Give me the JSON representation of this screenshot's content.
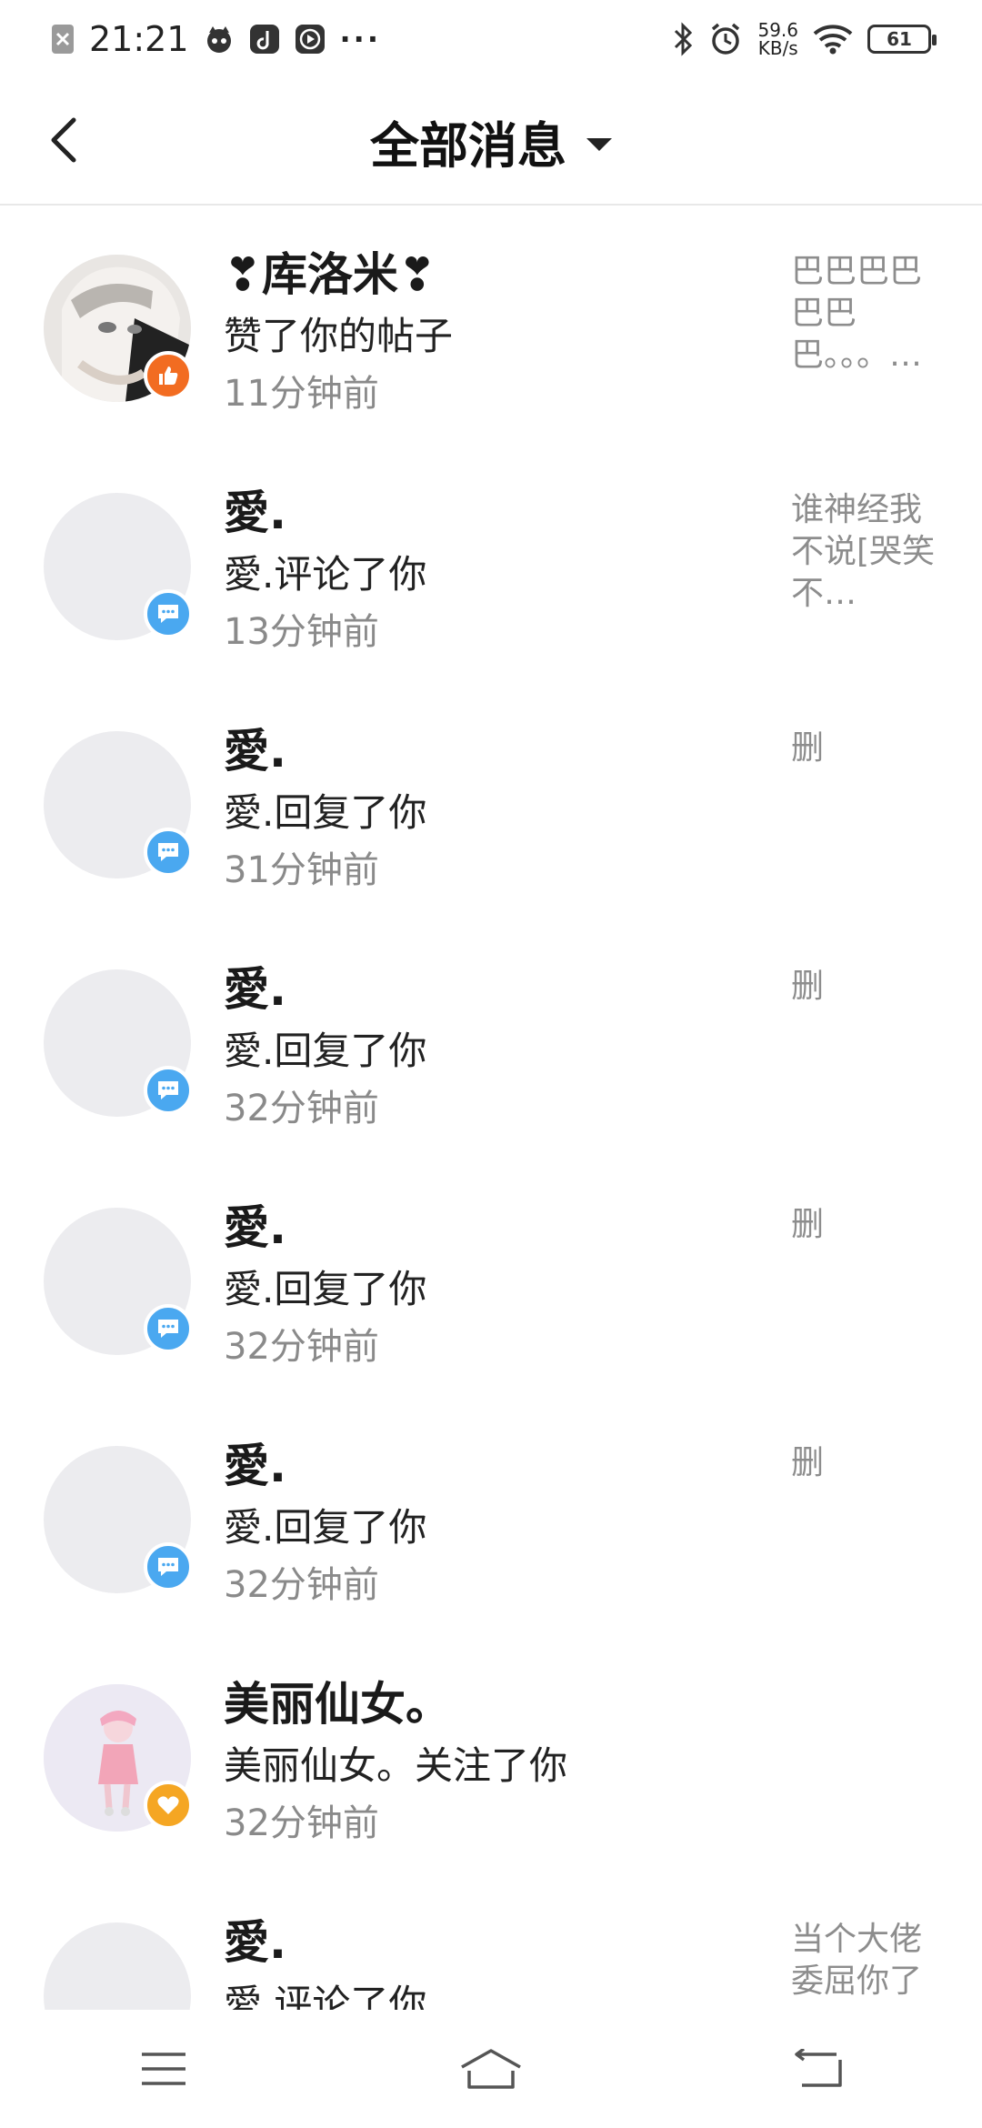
{
  "status_bar": {
    "time": "21:21",
    "net_speed_value": "59.6",
    "net_speed_unit": "KB/s",
    "battery": "61"
  },
  "header": {
    "title": "全部消息"
  },
  "messages": [
    {
      "name": "❣库洛米❣",
      "action": "赞了你的帖子",
      "time": "11分钟前",
      "preview": "巴巴巴巴巴巴巴。。。…",
      "badge": "like-icon",
      "badge_color": "#f26c21"
    },
    {
      "name": "愛.",
      "action": "愛.评论了你",
      "time": "13分钟前",
      "preview": "谁神经我不说[哭笑不…",
      "badge": "comment-icon",
      "badge_color": "#4aa8f0"
    },
    {
      "name": "愛.",
      "action": "愛.回复了你",
      "time": "31分钟前",
      "preview": "删",
      "badge": "comment-icon",
      "badge_color": "#4aa8f0"
    },
    {
      "name": "愛.",
      "action": "愛.回复了你",
      "time": "32分钟前",
      "preview": "删",
      "badge": "comment-icon",
      "badge_color": "#4aa8f0"
    },
    {
      "name": "愛.",
      "action": "愛.回复了你",
      "time": "32分钟前",
      "preview": "删",
      "badge": "comment-icon",
      "badge_color": "#4aa8f0"
    },
    {
      "name": "愛.",
      "action": "愛.回复了你",
      "time": "32分钟前",
      "preview": "删",
      "badge": "comment-icon",
      "badge_color": "#4aa8f0"
    },
    {
      "name": "美丽仙女。",
      "action": "美丽仙女。关注了你",
      "time": "32分钟前",
      "preview": "",
      "badge": "heart-icon",
      "badge_color": "#f5a623"
    },
    {
      "name": "愛.",
      "action": "愛.评论了你",
      "time": "",
      "preview": "当个大佬委屈你了",
      "badge": "comment-icon",
      "badge_color": "#4aa8f0"
    }
  ],
  "nav": {
    "icons": [
      "menu-icon",
      "home-icon",
      "back-icon"
    ]
  }
}
